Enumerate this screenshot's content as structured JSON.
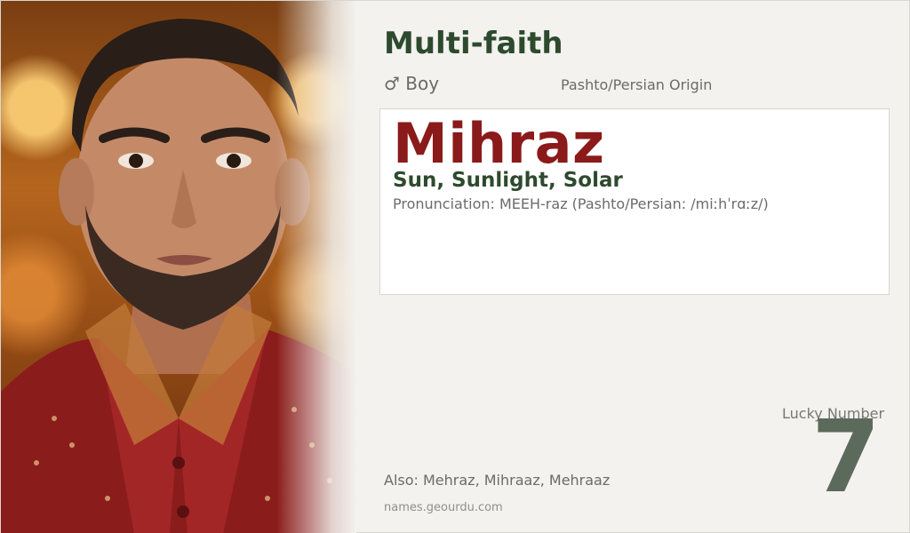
{
  "header": {
    "religion": "Multi-faith",
    "gender": "♂ Boy",
    "origin": "Pashto/Persian Origin"
  },
  "name_card": {
    "name": "Mihraz",
    "meaning": "Sun, Sunlight, Solar",
    "pronunciation": "Pronunciation: MEEH-raz (Pashto/Persian: /miːhˈrɑːz/)"
  },
  "lucky": {
    "label": "Lucky Number",
    "value": "7"
  },
  "footer": {
    "also": "Also: Mehraz, Mihraaz, Mehraaz",
    "site": "names.geourdu.com"
  },
  "colors": {
    "title_green": "#2e4a2e",
    "name_red": "#8b1a1a",
    "lucky_gray": "#5c6a5c",
    "background": "#f3f2ee"
  }
}
